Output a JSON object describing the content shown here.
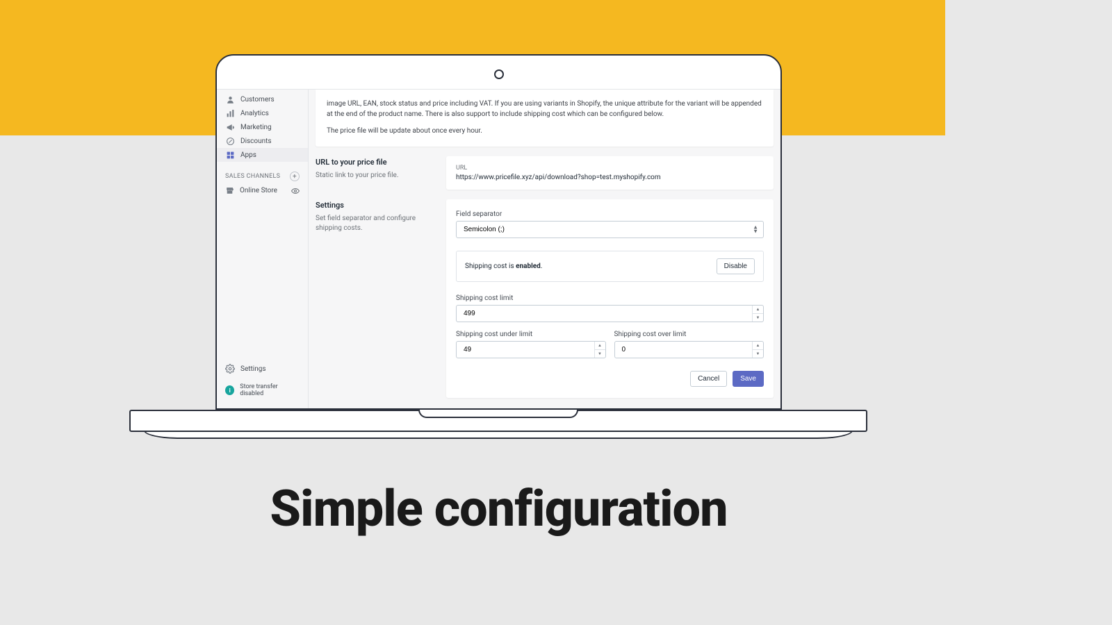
{
  "headline": "Simple configuration",
  "sidebar": {
    "items": [
      {
        "label": "Customers"
      },
      {
        "label": "Analytics"
      },
      {
        "label": "Marketing"
      },
      {
        "label": "Discounts"
      },
      {
        "label": "Apps"
      }
    ],
    "section_title": "SALES CHANNELS",
    "channel_label": "Online Store",
    "settings_label": "Settings",
    "transfer_label": "Store transfer disabled"
  },
  "info": {
    "line1": "image URL, EAN, stock status and price including VAT. If you are using variants in Shopify, the unique attribute for the variant will be appended at the end of the product name. There is also support to include shipping cost which can be configured below.",
    "line2": "The price file will be update about once every hour."
  },
  "url_section": {
    "heading": "URL to your price file",
    "desc": "Static link to your price file.",
    "label": "URL",
    "value": "https://www.pricefile.xyz/api/download?shop=test.myshopify.com"
  },
  "settings": {
    "heading": "Settings",
    "desc": "Set field separator and configure shipping costs.",
    "field_separator_label": "Field separator",
    "field_separator_value": "Semicolon (;)",
    "shipping_status_prefix": "Shipping cost is ",
    "shipping_status_bold": "enabled",
    "shipping_status_suffix": ".",
    "disable_label": "Disable",
    "limit_label": "Shipping cost limit",
    "limit_value": "499",
    "under_label": "Shipping cost under limit",
    "under_value": "49",
    "over_label": "Shipping cost over limit",
    "over_value": "0",
    "cancel_label": "Cancel",
    "save_label": "Save"
  }
}
